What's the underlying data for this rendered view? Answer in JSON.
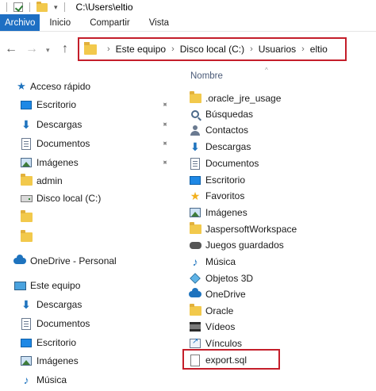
{
  "window": {
    "title": "C:\\Users\\eltio"
  },
  "ribbon": {
    "tabs": [
      "Archivo",
      "Inicio",
      "Compartir",
      "Vista"
    ]
  },
  "breadcrumb": [
    "Este equipo",
    "Disco local (C:)",
    "Usuarios",
    "eltio"
  ],
  "nav_pane": {
    "quick_access": "Acceso rápido",
    "quick_items": [
      "Escritorio",
      "Descargas",
      "Documentos",
      "Imágenes",
      "admin",
      "Disco local (C:)"
    ],
    "onedrive": "OneDrive - Personal",
    "this_pc": "Este equipo",
    "pc_items": [
      "Descargas",
      "Documentos",
      "Escritorio",
      "Imágenes",
      "Música"
    ]
  },
  "content": {
    "column_header": "Nombre",
    "items": [
      {
        "name": ".oracle_jre_usage",
        "icon": "folder-icon"
      },
      {
        "name": "Búsquedas",
        "icon": "search-icon"
      },
      {
        "name": "Contactos",
        "icon": "contacts-icon"
      },
      {
        "name": "Descargas",
        "icon": "download-icon"
      },
      {
        "name": "Documentos",
        "icon": "document-icon"
      },
      {
        "name": "Escritorio",
        "icon": "desktop-icon"
      },
      {
        "name": "Favoritos",
        "icon": "star-icon"
      },
      {
        "name": "Imágenes",
        "icon": "image-icon"
      },
      {
        "name": "JaspersoftWorkspace",
        "icon": "folder-icon"
      },
      {
        "name": "Juegos guardados",
        "icon": "gamepad-icon"
      },
      {
        "name": "Música",
        "icon": "music-icon"
      },
      {
        "name": "Objetos 3D",
        "icon": "cube-icon"
      },
      {
        "name": "OneDrive",
        "icon": "cloud-icon"
      },
      {
        "name": "Oracle",
        "icon": "folder-icon"
      },
      {
        "name": "Vídeos",
        "icon": "video-icon"
      },
      {
        "name": "Vínculos",
        "icon": "links-icon"
      },
      {
        "name": "export.sql",
        "icon": "file-icon"
      }
    ]
  },
  "colors": {
    "accent": "#1e6fc3",
    "highlight_border": "#c41e2a",
    "folder": "#f2c94c"
  }
}
